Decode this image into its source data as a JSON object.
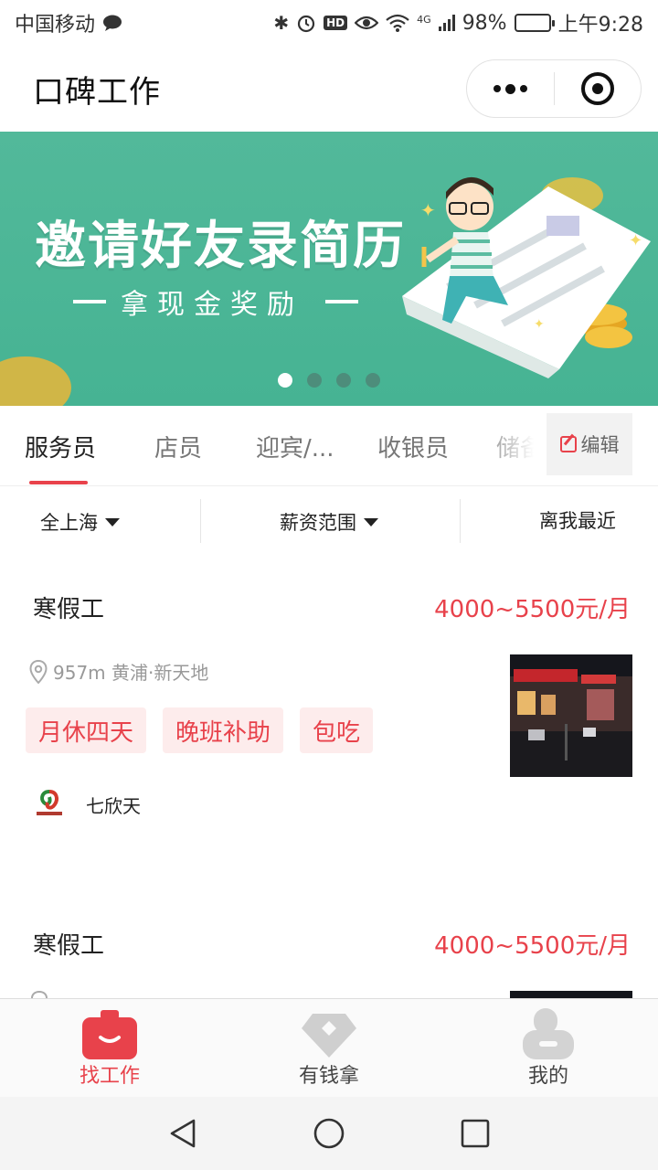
{
  "status_bar": {
    "carrier": "中国移动",
    "hd": "HD",
    "network": "4G",
    "battery": "98%",
    "battery_level": 0.98,
    "time": "上午9:28"
  },
  "app": {
    "title": "口碑工作"
  },
  "banner": {
    "headline": "邀请好友录简历",
    "subline": "拿现金奖励",
    "pages": 4,
    "active_page": 0
  },
  "tabs": {
    "items": [
      "服务员",
      "店员",
      "迎宾/...",
      "收银员",
      "储备"
    ],
    "active": 0,
    "edit_label": "编辑"
  },
  "filters": {
    "area": "全上海",
    "salary": "薪资范围",
    "sort": "离我最近"
  },
  "jobs": [
    {
      "title": "寒假工",
      "salary": "4000~5500元/月",
      "location": "957m 黄浦·新天地",
      "tags": [
        "月休四天",
        "晚班补助",
        "包吃"
      ],
      "company": "七欣天"
    },
    {
      "title": "寒假工",
      "salary": "4000~5500元/月"
    }
  ],
  "bottom_nav": {
    "items": [
      {
        "label": "找工作",
        "icon": "briefcase-icon"
      },
      {
        "label": "有钱拿",
        "icon": "diamond-icon"
      },
      {
        "label": "我的",
        "icon": "profile-icon"
      }
    ],
    "active": 0
  },
  "colors": {
    "accent": "#e8424b",
    "banner": "#4db697",
    "tag_bg": "#fdecec"
  }
}
